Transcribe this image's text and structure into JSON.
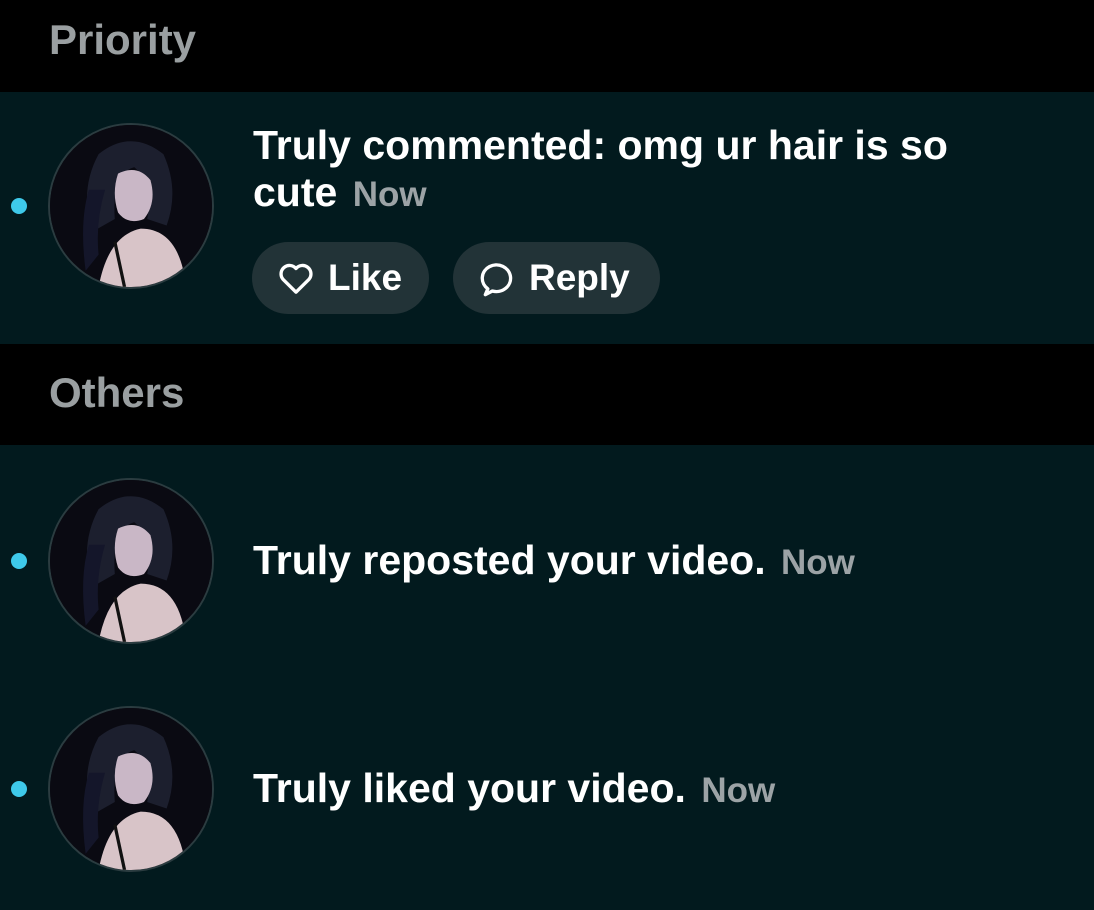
{
  "sections": {
    "priority": {
      "title": "Priority"
    },
    "others": {
      "title": "Others"
    }
  },
  "notifications": [
    {
      "text": "Truly commented: omg ur hair is so cute",
      "time": "Now",
      "actions": {
        "like_label": "Like",
        "reply_label": "Reply"
      },
      "unread": true,
      "avatar_icon": "user-avatar-photo"
    },
    {
      "text": "Truly reposted your video.",
      "time": "Now",
      "unread": true,
      "avatar_icon": "user-avatar-photo"
    },
    {
      "text": "Truly liked your video.",
      "time": "Now",
      "unread": true,
      "avatar_icon": "user-avatar-photo"
    }
  ],
  "colors": {
    "background": "#021a1e",
    "section_header_bg": "#000000",
    "section_header_text": "#9a9fa1",
    "unread_dot": "#3ec9ea",
    "pill_bg": "#223337",
    "timestamp": "#9ca3a6"
  }
}
